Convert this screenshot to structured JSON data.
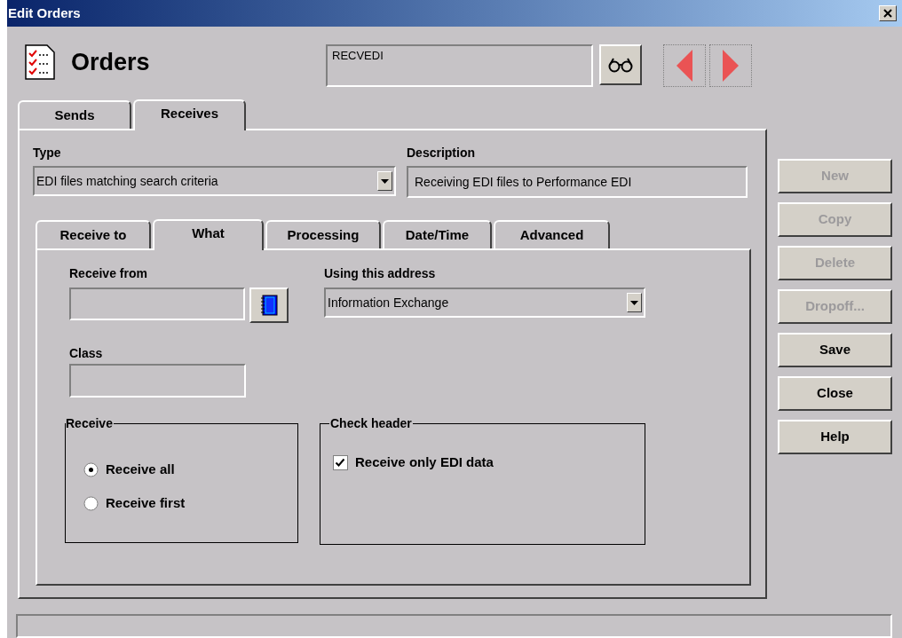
{
  "window": {
    "title": "Edit Orders"
  },
  "header": {
    "title": "Orders",
    "record": "RECVEDI",
    "nav": [
      {
        "kind": "prev",
        "disabled": true
      },
      {
        "kind": "next",
        "disabled": true
      }
    ]
  },
  "tabs": [
    {
      "label": "Sends",
      "selected": false
    },
    {
      "label": "Receives",
      "selected": true
    }
  ],
  "type": {
    "label": "Type",
    "value": "EDI files matching search criteria"
  },
  "description": {
    "label": "Description",
    "value": "Receiving EDI files to Performance EDI"
  },
  "inner_tabs": [
    {
      "label": "Receive to",
      "selected": false
    },
    {
      "label": "What",
      "selected": true
    },
    {
      "label": "Processing",
      "selected": false
    },
    {
      "label": "Date/Time",
      "selected": false
    },
    {
      "label": "Advanced",
      "selected": false
    }
  ],
  "receive_from": {
    "label": "Receive from"
  },
  "address": {
    "label": "Using this address",
    "value": "Information Exchange"
  },
  "class": {
    "label": "Class"
  },
  "receive_group": {
    "title": "Receive",
    "options": [
      {
        "label": "Receive all",
        "selected": true
      },
      {
        "label": "Receive first",
        "selected": false
      }
    ]
  },
  "check_header": {
    "title": "Check header",
    "options": [
      {
        "label": "Receive only EDI data",
        "checked": true
      }
    ]
  },
  "buttons": [
    {
      "label": "New",
      "disabled": true
    },
    {
      "label": "Copy",
      "disabled": true
    },
    {
      "label": "Delete",
      "disabled": true
    },
    {
      "label": "Dropoff...",
      "disabled": true
    },
    {
      "label": "Save",
      "disabled": false
    },
    {
      "label": "Close",
      "disabled": false
    },
    {
      "label": "Help",
      "disabled": false
    }
  ]
}
